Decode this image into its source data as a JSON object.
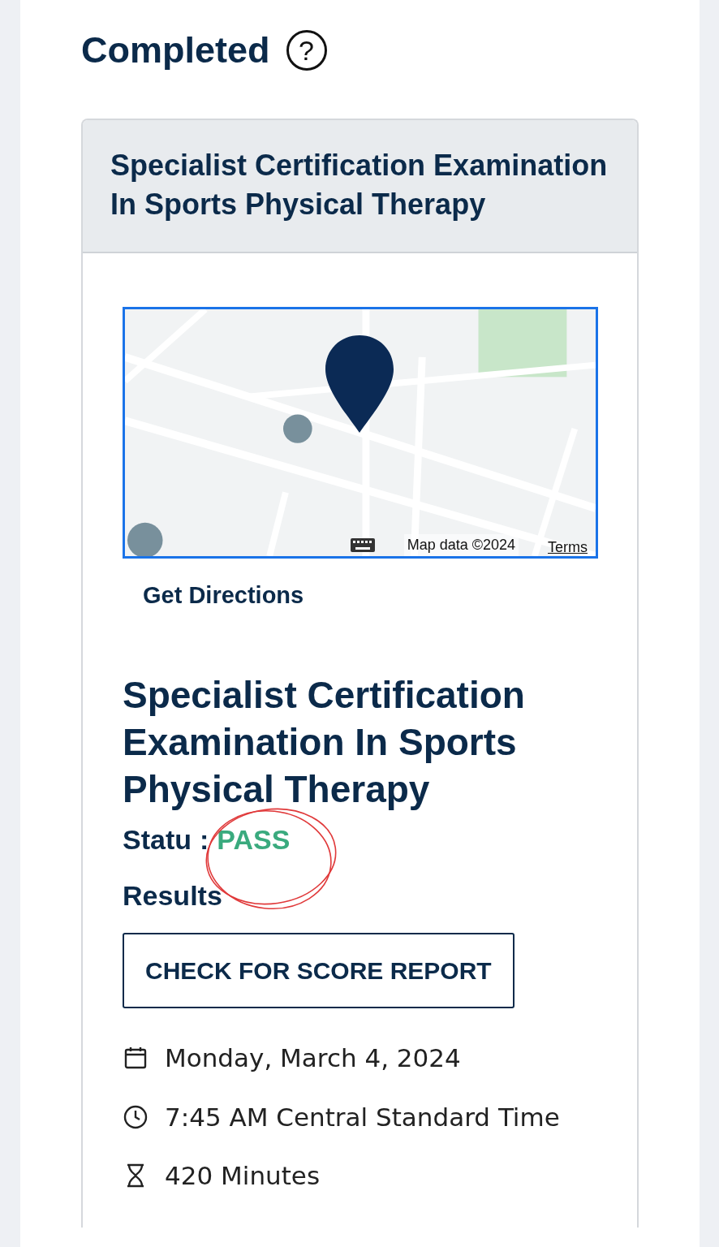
{
  "heading": {
    "title": "Completed",
    "help_icon": "?"
  },
  "exam": {
    "header_title": "Specialist Certification Examination In Sports Physical Therapy",
    "map": {
      "attribution": "Map data ©2024",
      "terms": "Terms"
    },
    "directions_link": "Get Directions",
    "title": "Specialist Certification Examination In Sports Physical Therapy",
    "status": {
      "label": "Statu",
      "separator": ":",
      "value": "PASS",
      "kind": "pass"
    },
    "results_label": "Results",
    "score_button": "CHECK FOR SCORE REPORT",
    "details": [
      {
        "kind": "date",
        "text": "Monday, March 4, 2024"
      },
      {
        "kind": "time",
        "text": "7:45 AM Central Standard Time"
      },
      {
        "kind": "duration",
        "text": "420 Minutes"
      }
    ]
  }
}
